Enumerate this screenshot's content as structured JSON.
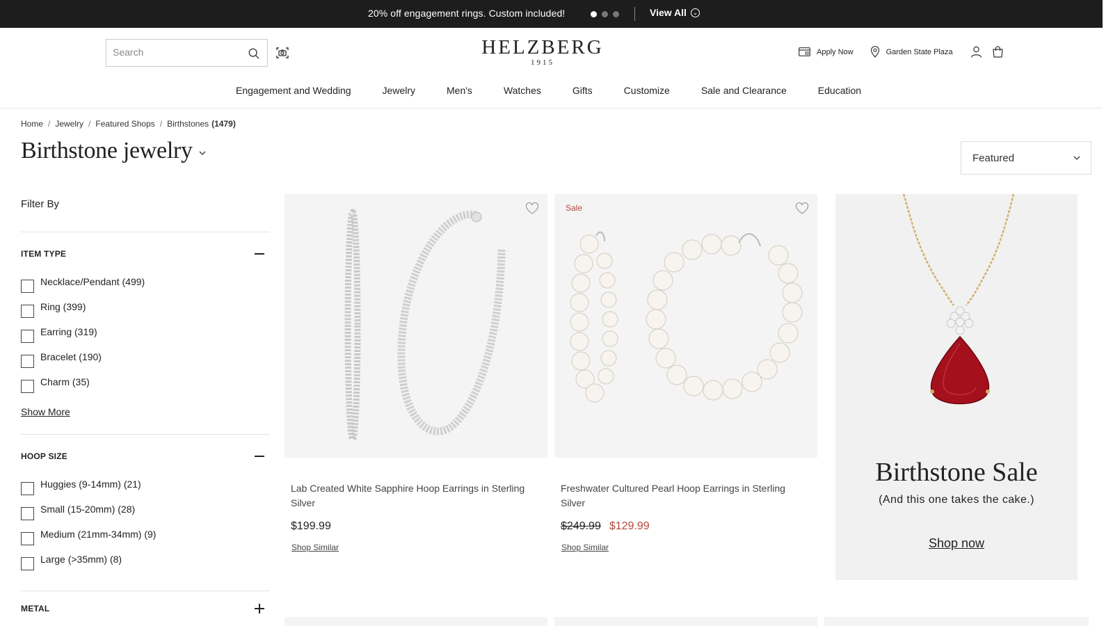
{
  "promo_bar": {
    "message": "20% off engagement rings. Custom included!",
    "view_all": "View All",
    "colors": {
      "background": "#1d1d1d",
      "text": "#ffffff"
    }
  },
  "header": {
    "search_placeholder": "Search",
    "logo_name": "HELZBERG",
    "logo_year": "1915",
    "apply_now": "Apply Now",
    "store": "Garden State Plaza"
  },
  "nav": {
    "items": [
      "Engagement and Wedding",
      "Jewelry",
      "Men's",
      "Watches",
      "Gifts",
      "Customize",
      "Sale and Clearance",
      "Education"
    ]
  },
  "breadcrumb": {
    "items": [
      "Home",
      "Jewelry",
      "Featured Shops",
      "Birthstones"
    ],
    "count": "(1479)"
  },
  "page": {
    "title": "Birthstone jewelry",
    "sort_value": "Featured"
  },
  "filters": {
    "heading": "Filter By",
    "sections": [
      {
        "title": "ITEM TYPE",
        "expanded": true,
        "options": [
          "Necklace/Pendant  (499)",
          "Ring  (399)",
          "Earring  (319)",
          "Bracelet  (190)",
          "Charm  (35)"
        ],
        "show_more": "Show More"
      },
      {
        "title": "HOOP SIZE",
        "expanded": true,
        "options": [
          "Huggies (9-14mm)  (21)",
          "Small (15-20mm)  (28)",
          "Medium (21mm-34mm)  (9)",
          "Large (>35mm)  (8)"
        ]
      },
      {
        "title": "METAL",
        "expanded": false
      }
    ]
  },
  "products": [
    {
      "name": "Lab Created White Sapphire Hoop Earrings in Sterling Silver",
      "price": "$199.99",
      "shop_similar": "Shop Similar"
    },
    {
      "sale_tag": "Sale",
      "name": "Freshwater Cultured Pearl Hoop Earrings in Sterling Silver",
      "price_original": "$249.99",
      "price_sale": "$129.99",
      "shop_similar": "Shop Similar"
    }
  ],
  "promo_card": {
    "title": "Birthstone Sale",
    "subtitle": "(And this one takes the cake.)",
    "cta": "Shop now"
  },
  "colors": {
    "sale_red": "#b14a3c",
    "image_bg": "#f4f4f4",
    "promo_bg": "#f1f1f1"
  },
  "icons": [
    "search-icon",
    "visual-search-icon",
    "credit-card-icon",
    "location-pin-icon",
    "account-icon",
    "cart-icon",
    "heart-icon",
    "chevron-down-icon",
    "minus-icon",
    "plus-icon"
  ]
}
